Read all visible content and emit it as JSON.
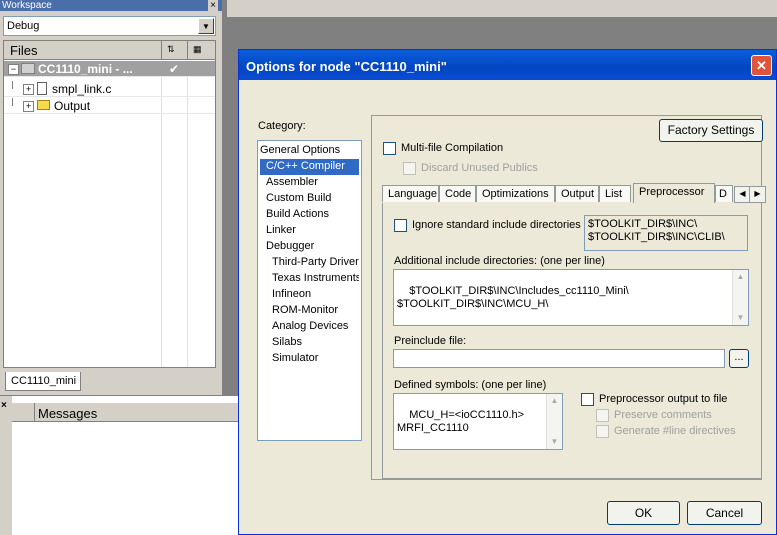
{
  "workspace": {
    "title": "Workspace",
    "close_glyph": "×",
    "config_value": "Debug",
    "files_header": "Files",
    "tree": [
      {
        "label": "CC1110_mini - ...",
        "check": "✔"
      },
      {
        "label": "smpl_link.c"
      },
      {
        "label": "Output"
      }
    ],
    "tab_label": "CC1110_mini"
  },
  "messages": {
    "close_glyph": "×",
    "header": "Messages"
  },
  "dialog": {
    "title": "Options for node \"CC1110_mini\"",
    "close_glyph": "✕",
    "category_label": "Category:",
    "categories": [
      "General Options",
      "C/C++ Compiler",
      "Assembler",
      "Custom Build",
      "Build Actions",
      "Linker",
      "Debugger",
      "Third-Party Driver",
      "Texas Instruments",
      "Infineon",
      "ROM-Monitor",
      "Analog Devices",
      "Silabs",
      "Simulator"
    ],
    "selected_category": "C/C++ Compiler",
    "factory_settings": "Factory Settings",
    "multi_file": "Multi-file Compilation",
    "discard_unused": "Discard Unused Publics",
    "tabs": [
      "Language",
      "Code",
      "Optimizations",
      "Output",
      "List",
      "Preprocessor",
      "D"
    ],
    "active_tab": "Preprocessor",
    "ignore_std": "Ignore standard include directories",
    "std_dirs": "$TOOLKIT_DIR$\\INC\\\n$TOOLKIT_DIR$\\INC\\CLIB\\",
    "additional_label": "Additional include directories: (one per line)",
    "additional_dirs": "$TOOLKIT_DIR$\\INC\\Includes_cc1110_Mini\\\n$TOOLKIT_DIR$\\INC\\MCU_H\\",
    "preinclude_label": "Preinclude file:",
    "preinclude_value": "",
    "browse_label": "...",
    "defined_label": "Defined symbols: (one per line)",
    "defined_symbols": "MCU_H=<ioCC1110.h>\nMRFI_CC1110",
    "pp_output": "Preprocessor output to file",
    "preserve_comments": "Preserve comments",
    "generate_line": "Generate #line directives",
    "ok": "OK",
    "cancel": "Cancel"
  },
  "colors": {
    "title_bar": "#0a5ddc",
    "selection": "#316ac5",
    "dialog_bg": "#ece9d8"
  }
}
